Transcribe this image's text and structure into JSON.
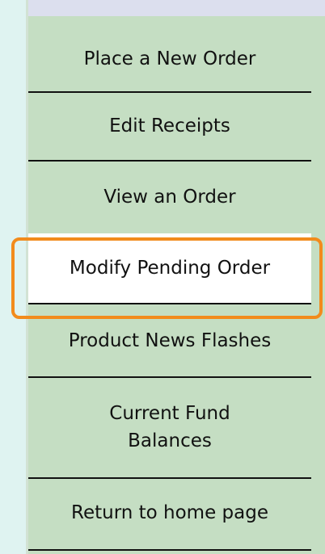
{
  "menu": {
    "items": [
      {
        "label": "Place a New Order"
      },
      {
        "label": "Edit Receipts"
      },
      {
        "label": "View an Order"
      },
      {
        "label": "Modify Pending Order",
        "active": true
      },
      {
        "label": "Product News Flashes"
      },
      {
        "label": "Current Fund Balances"
      },
      {
        "label": "Return to home page"
      }
    ]
  },
  "colors": {
    "background": "#dff3f1",
    "menu_bg": "#c5dec3",
    "active_bg": "#ffffff",
    "divider": "#111111",
    "highlight": "#f28b1c"
  }
}
